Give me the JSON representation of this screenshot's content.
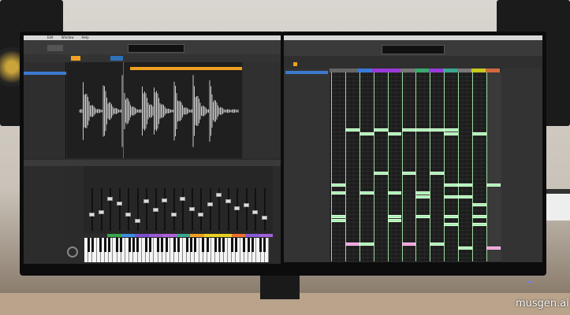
{
  "left_app": {
    "menu": [
      "Edit",
      "Window",
      "Help"
    ],
    "waveform_color": "#c8c8c8",
    "region_bar_color": "#f0a020",
    "playhead_color": "#e03030",
    "playhead_position": 0.32
  },
  "mixer": {
    "fader_levels": [
      0.38,
      0.45,
      0.78,
      0.67,
      0.39,
      0.22,
      0.72,
      0.5,
      0.75,
      0.38,
      0.78,
      0.53,
      0.39,
      0.65,
      0.88,
      0.72,
      0.55,
      0.62,
      0.45,
      0.3
    ],
    "color_strip": [
      "#3aa64a",
      "#3a8fe0",
      "#7a4fd0",
      "#9a5ad8",
      "#b060d8",
      "#3aa890",
      "#f0a020",
      "#e8d020",
      "#e8d020",
      "#f07030",
      "#8a5ad8",
      "#a060d8"
    ],
    "header_colors": [
      "#3aa64a",
      "#3a8fe0",
      "#f0a020"
    ]
  },
  "right_app": {
    "header_colors": [
      "#666",
      "#666",
      "#3a7ad8",
      "#9a3ad8",
      "#9a3ad8",
      "#777",
      "#3aa870",
      "#9a3ad8",
      "#3aa890",
      "#777",
      "#c8c820",
      "#d06a40"
    ],
    "note_color": "#a6f0b0",
    "accent_note_color": "#f19ad8",
    "notes": [
      {
        "beat": 1,
        "pitch": 31
      },
      {
        "beat": 2,
        "pitch": 30
      },
      {
        "beat": 3,
        "pitch": 31
      },
      {
        "beat": 4,
        "pitch": 30
      },
      {
        "beat": 5,
        "pitch": 31
      },
      {
        "beat": 6,
        "pitch": 31
      },
      {
        "beat": 7,
        "pitch": 31
      },
      {
        "beat": 8,
        "pitch": 30
      },
      {
        "beat": 8,
        "pitch": 31
      },
      {
        "beat": 10,
        "pitch": 30
      },
      {
        "beat": 3,
        "pitch": 20
      },
      {
        "beat": 5,
        "pitch": 20
      },
      {
        "beat": 7,
        "pitch": 20
      },
      {
        "beat": 0,
        "pitch": 17
      },
      {
        "beat": 8,
        "pitch": 17
      },
      {
        "beat": 9,
        "pitch": 17
      },
      {
        "beat": 11,
        "pitch": 17
      },
      {
        "beat": 2,
        "pitch": 15
      },
      {
        "beat": 4,
        "pitch": 15
      },
      {
        "beat": 6,
        "pitch": 15
      },
      {
        "beat": 0,
        "pitch": 15
      },
      {
        "beat": 6,
        "pitch": 14
      },
      {
        "beat": 8,
        "pitch": 14
      },
      {
        "beat": 9,
        "pitch": 14
      },
      {
        "beat": 10,
        "pitch": 12
      },
      {
        "beat": 0,
        "pitch": 9
      },
      {
        "beat": 0,
        "pitch": 8
      },
      {
        "beat": 4,
        "pitch": 9
      },
      {
        "beat": 4,
        "pitch": 8
      },
      {
        "beat": 6,
        "pitch": 9
      },
      {
        "beat": 8,
        "pitch": 9
      },
      {
        "beat": 8,
        "pitch": 7
      },
      {
        "beat": 10,
        "pitch": 9
      },
      {
        "beat": 10,
        "pitch": 7
      },
      {
        "beat": 1,
        "pitch": 2,
        "accent": true
      },
      {
        "beat": 5,
        "pitch": 2,
        "accent": true
      },
      {
        "beat": 11,
        "pitch": 1,
        "accent": true
      },
      {
        "beat": 2,
        "pitch": 2
      },
      {
        "beat": 7,
        "pitch": 2
      },
      {
        "beat": 9,
        "pitch": 1
      }
    ]
  },
  "watermark": "musgen.ai"
}
